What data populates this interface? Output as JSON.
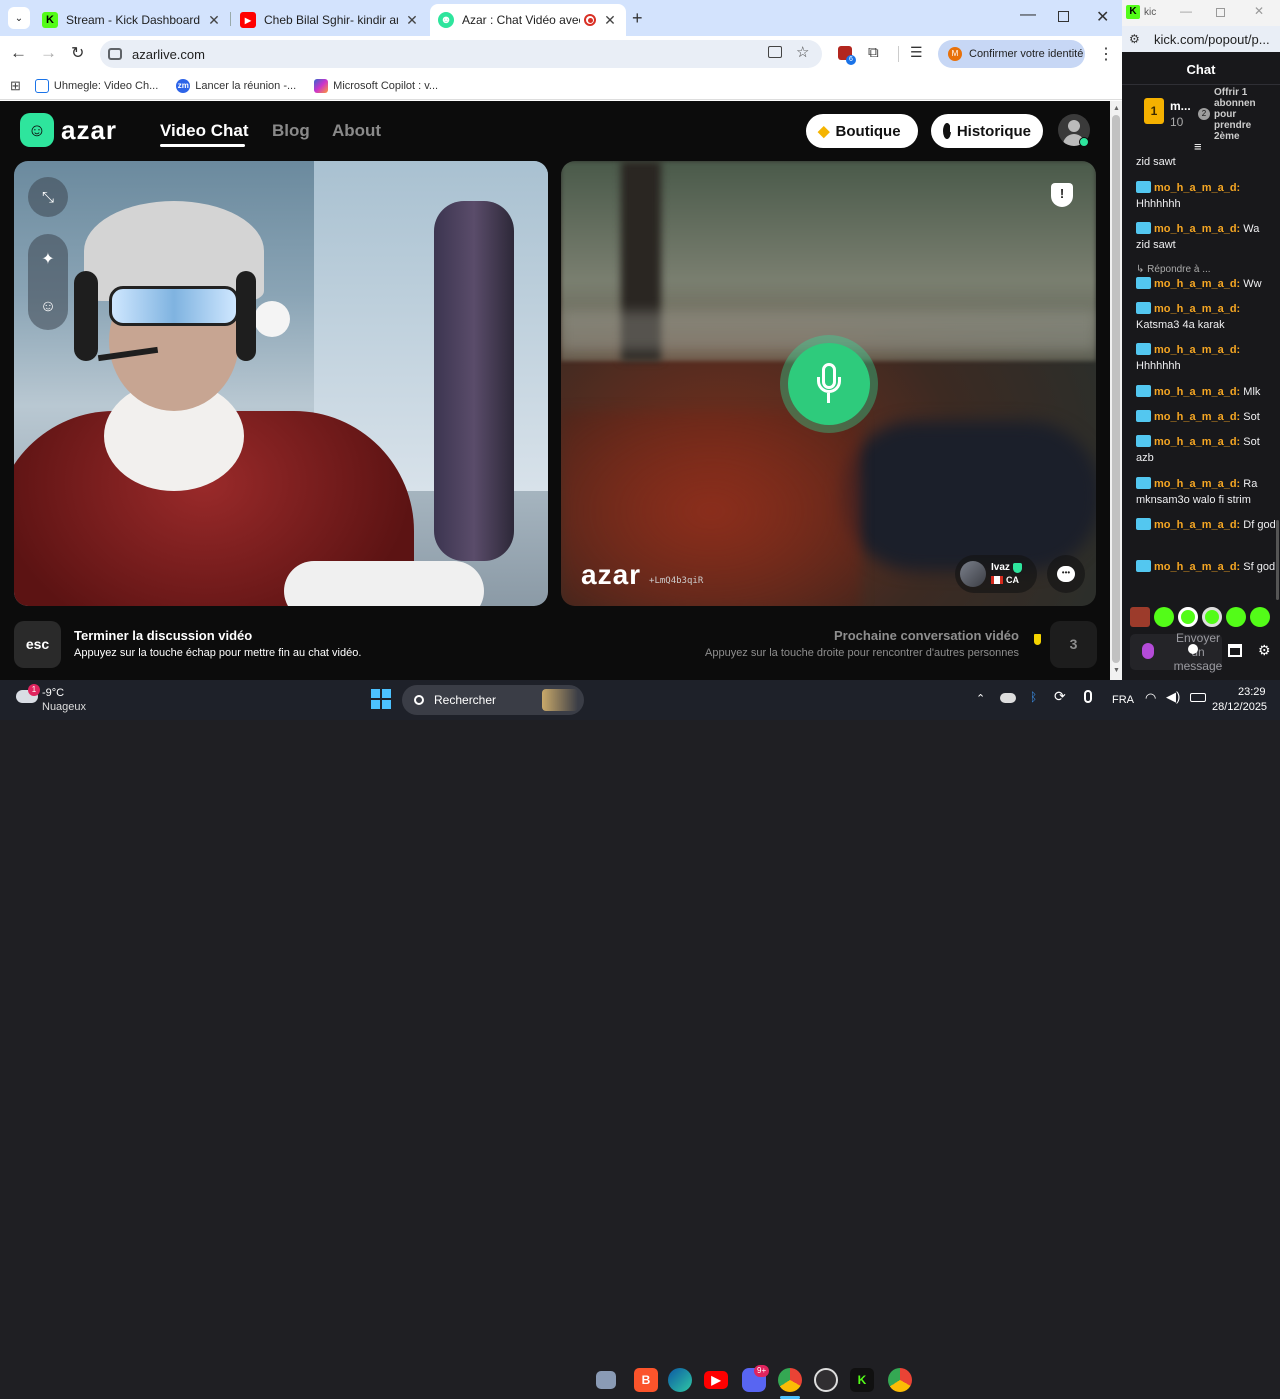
{
  "tabs": [
    {
      "title": "Stream - Kick Dashboard",
      "icon": "K",
      "color": "#53fc18"
    },
    {
      "title": "Cheb Bilal Sghir- kindir ana - Yo",
      "icon": "▶",
      "color": "#ff0000"
    },
    {
      "title": "Azar : Chat Vidéo avec de n",
      "icon": "☻",
      "color": "#2ee59d"
    }
  ],
  "url": "azarlive.com",
  "profile_label": "Confirmer votre identité",
  "bookmarks": [
    "Uhmegle: Video Ch...",
    "Lancer la réunion -...",
    "Microsoft Copilot : v..."
  ],
  "site": {
    "logo": "azar",
    "nav": [
      "Video Chat",
      "Blog",
      "About"
    ],
    "shop_label": "Boutique",
    "history_label": "Historique",
    "watermark": "azar",
    "watermark_id": "+LmQ4b3qiR",
    "peer_name": "Ivaz",
    "peer_country": "CA",
    "esc_key": "esc",
    "end_title": "Terminer la discussion vidéo",
    "end_hint": "Appuyez sur la touche échap pour mettre fin au chat vidéo.",
    "next_title": "Prochaine conversation vidéo",
    "next_hint": "Appuyez sur la touche droite pour rencontrer d'autres personnes",
    "next_count": "3",
    "accent": "#2ee59d"
  },
  "kick": {
    "window_title": "kic",
    "url": "kick.com/popout/p...",
    "chat_title": "Chat",
    "gift_name": "m...",
    "gift_count": "10",
    "gift_rank": "2",
    "gift_text": "Offrir 1 abonnen pour prendre 2ème",
    "top_line": "zid sawt",
    "reply_label": "↳ Répondre à ...",
    "messages": [
      {
        "user": "mo_h_a_m_a_d:",
        "text": "Hhhhhhh"
      },
      {
        "user": "mo_h_a_m_a_d:",
        "text": "Wa zid sawt"
      },
      {
        "user": "mo_h_a_m_a_d:",
        "text": "Ww"
      },
      {
        "user": "mo_h_a_m_a_d:",
        "text": "Katsma3 4a karak"
      },
      {
        "user": "mo_h_a_m_a_d:",
        "text": "Hhhhhhh"
      },
      {
        "user": "mo_h_a_m_a_d:",
        "text": "Mlk"
      },
      {
        "user": "mo_h_a_m_a_d:",
        "text": "Sot"
      },
      {
        "user": "mo_h_a_m_a_d:",
        "text": "Sot azb"
      },
      {
        "user": "mo_h_a_m_a_d:",
        "text": "Ra mknsam3o walo fi strim"
      },
      {
        "user": "mo_h_a_m_a_d:",
        "text": "Df god"
      },
      {
        "user": "mo_h_a_m_a_d:",
        "text": "Sf god"
      }
    ],
    "input_placeholder": "Envoyer un message"
  },
  "taskbar": {
    "weather_temp": "-9°C",
    "weather_desc": "Nuageux",
    "weather_badge": "1",
    "search_label": "Rechercher",
    "lang": "FRA",
    "time": "23:29",
    "date": "28/12/2025",
    "discord_badge": "9+"
  }
}
